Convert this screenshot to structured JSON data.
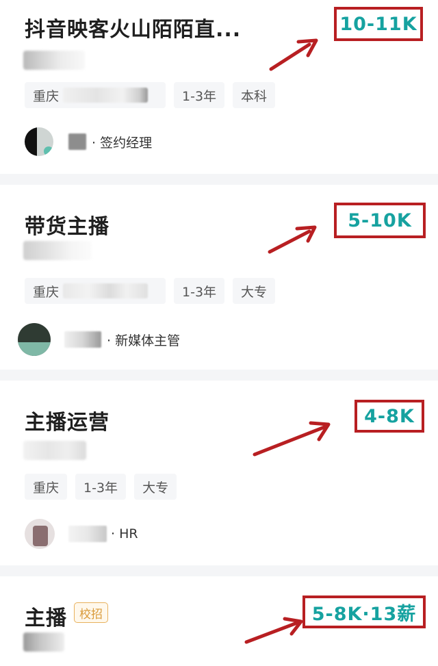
{
  "jobs": [
    {
      "title": "抖音映客火山陌陌直...",
      "salary": "10-11K",
      "tags": [
        "重庆",
        "1-3年",
        "本科"
      ],
      "recruiter_role": "· 签约经理"
    },
    {
      "title": "带货主播",
      "salary": "5-10K",
      "tags": [
        "重庆",
        "1-3年",
        "大专"
      ],
      "recruiter_role": "· 新媒体主管"
    },
    {
      "title": "主播运营",
      "salary": "4-8K",
      "tags": [
        "重庆",
        "1-3年",
        "大专"
      ],
      "recruiter_role": "· HR"
    },
    {
      "title": "主播",
      "badge": "校招",
      "salary": "5-8K·13薪"
    }
  ],
  "colors": {
    "salary_text": "#16a2a0",
    "annotation_red": "#b81f22",
    "badge_orange": "#d99a39",
    "page_background": "#f4f5f7"
  },
  "icons": [
    "arrow-annotation-icon"
  ]
}
